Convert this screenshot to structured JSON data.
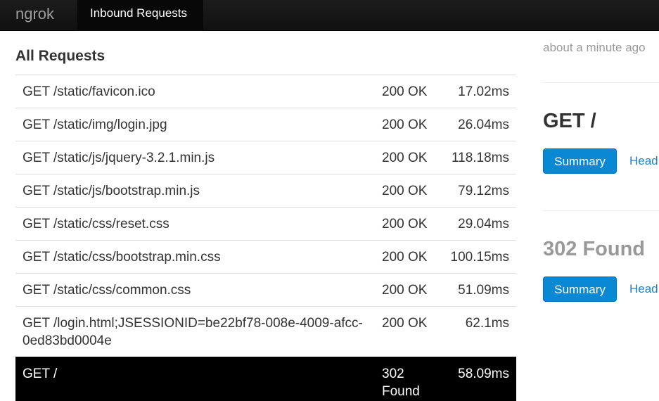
{
  "nav": {
    "brand": "ngrok",
    "tab": "Inbound Requests"
  },
  "main": {
    "heading": "All Requests",
    "requests": [
      {
        "path": "GET /static/favicon.ico",
        "status": "200 OK",
        "duration": "17.02ms"
      },
      {
        "path": "GET /static/img/login.jpg",
        "status": "200 OK",
        "duration": "26.04ms"
      },
      {
        "path": "GET /static/js/jquery-3.2.1.min.js",
        "status": "200 OK",
        "duration": "118.18ms"
      },
      {
        "path": "GET /static/js/bootstrap.min.js",
        "status": "200 OK",
        "duration": "79.12ms"
      },
      {
        "path": "GET /static/css/reset.css",
        "status": "200 OK",
        "duration": "29.04ms"
      },
      {
        "path": "GET /static/css/bootstrap.min.css",
        "status": "200 OK",
        "duration": "100.15ms"
      },
      {
        "path": "GET /static/css/common.css",
        "status": "200 OK",
        "duration": "51.09ms"
      },
      {
        "path": "GET /login.html;JSESSIONID=be22bf78-008e-4009-afcc-0ed83bd0004e",
        "status": "200 OK",
        "duration": "62.1ms"
      },
      {
        "path": "GET /",
        "status": "302 Found",
        "duration": "58.09ms",
        "selected": true
      }
    ]
  },
  "detail": {
    "time": "about a minute ago",
    "request_title": "GET /",
    "response_title": "302 Found",
    "summary_label": "Summary",
    "headers_label": "Head"
  },
  "colors": {
    "accent": "#0a88d4",
    "navbar": "#111111",
    "selected_row": "#000000"
  }
}
